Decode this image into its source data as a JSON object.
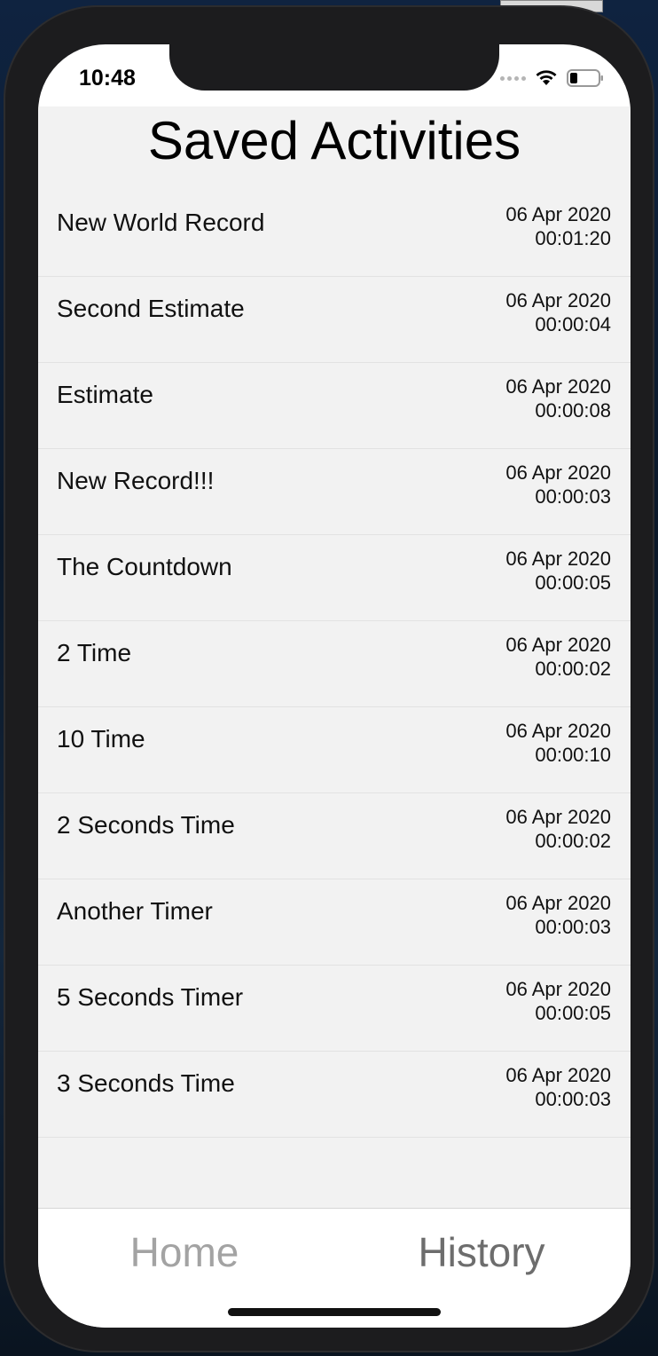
{
  "status_bar": {
    "time": "10:48",
    "icons": [
      "signal-dots-icon",
      "wifi-icon",
      "battery-icon"
    ]
  },
  "page": {
    "title": "Saved Activities"
  },
  "activities": [
    {
      "name": "New World Record",
      "date": "06 Apr 2020",
      "duration": "00:01:20"
    },
    {
      "name": "Second Estimate",
      "date": "06 Apr 2020",
      "duration": "00:00:04"
    },
    {
      "name": "Estimate",
      "date": "06 Apr 2020",
      "duration": "00:00:08"
    },
    {
      "name": "New Record!!!",
      "date": "06 Apr 2020",
      "duration": "00:00:03"
    },
    {
      "name": "The Countdown",
      "date": "06 Apr 2020",
      "duration": "00:00:05"
    },
    {
      "name": "2 Time",
      "date": "06 Apr 2020",
      "duration": "00:00:02"
    },
    {
      "name": "10 Time",
      "date": "06 Apr 2020",
      "duration": "00:00:10"
    },
    {
      "name": "2 Seconds Time",
      "date": "06 Apr 2020",
      "duration": "00:00:02"
    },
    {
      "name": "Another Timer",
      "date": "06 Apr 2020",
      "duration": "00:00:03"
    },
    {
      "name": "5 Seconds Timer",
      "date": "06 Apr 2020",
      "duration": "00:00:05"
    },
    {
      "name": "3 Seconds Time",
      "date": "06 Apr 2020",
      "duration": "00:00:03"
    }
  ],
  "tab_bar": {
    "home_label": "Home",
    "history_label": "History",
    "selected": "History"
  },
  "colors": {
    "list_background": "#f2f2f2",
    "tab_inactive": "#a3a3a3",
    "tab_active": "#6d6d6d"
  }
}
